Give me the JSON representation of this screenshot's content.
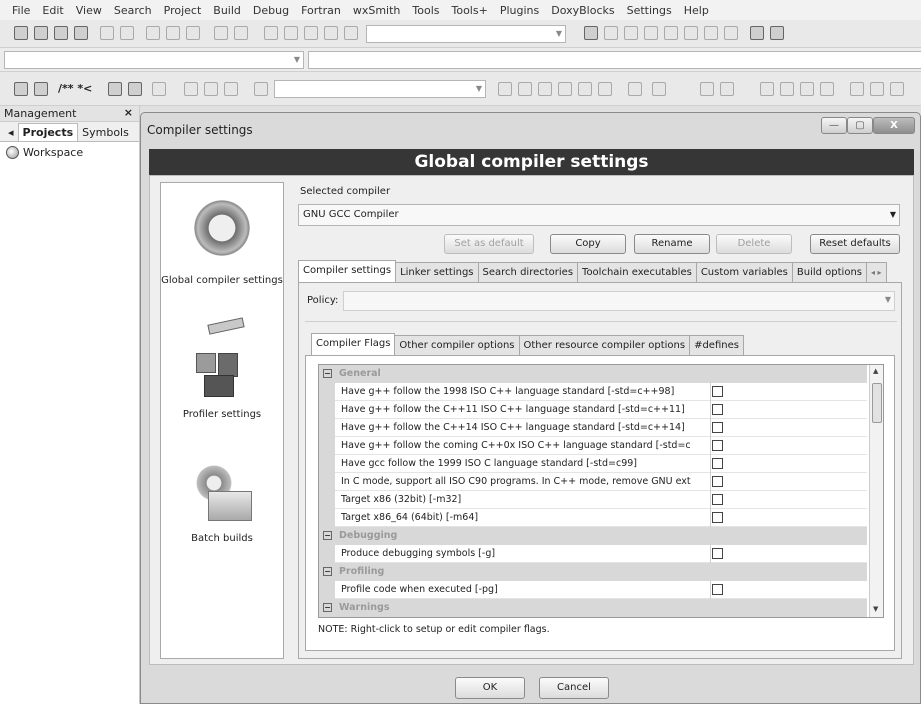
{
  "menu": [
    "File",
    "Edit",
    "View",
    "Search",
    "Project",
    "Build",
    "Debug",
    "Fortran",
    "wxSmith",
    "Tools",
    "Tools+",
    "Plugins",
    "DoxyBlocks",
    "Settings",
    "Help"
  ],
  "toolbar": {
    "comment_label": "/** *<"
  },
  "management": {
    "title": "Management",
    "close": "×",
    "tabs": [
      "Projects",
      "Symbols"
    ],
    "workspace": "Workspace"
  },
  "dialog": {
    "title": "Compiler settings",
    "header": "Global compiler settings",
    "window_buttons": {
      "minimize": "—",
      "maximize": "▢",
      "close": "X"
    },
    "sidebar": [
      {
        "label": "Global compiler settings",
        "icon": "gear-icon"
      },
      {
        "label": "Profiler settings",
        "icon": "caliper-icon"
      },
      {
        "label": "Batch builds",
        "icon": "batch-gear-icon"
      }
    ],
    "selected_compiler_label": "Selected compiler",
    "selected_compiler_value": "GNU GCC Compiler",
    "buttons": {
      "set_default": "Set as default",
      "copy": "Copy",
      "rename": "Rename",
      "delete": "Delete",
      "reset": "Reset defaults",
      "ok": "OK",
      "cancel": "Cancel"
    },
    "tabs": [
      "Compiler settings",
      "Linker settings",
      "Search directories",
      "Toolchain executables",
      "Custom variables",
      "Build options"
    ],
    "policy_label": "Policy:",
    "inner_tabs": [
      "Compiler Flags",
      "Other compiler options",
      "Other resource compiler options",
      "#defines"
    ],
    "flags": [
      {
        "type": "cat",
        "text": "General"
      },
      {
        "type": "opt",
        "text": "Have g++ follow the 1998 ISO C++ language standard  [-std=c++98]",
        "checked": false
      },
      {
        "type": "opt",
        "text": "Have g++ follow the C++11 ISO C++ language standard  [-std=c++11]",
        "checked": false
      },
      {
        "type": "opt",
        "text": "Have g++ follow the C++14 ISO C++ language standard  [-std=c++14]",
        "checked": false
      },
      {
        "type": "opt",
        "text": "Have g++ follow the coming C++0x ISO C++ language standard  [-std=c",
        "checked": false
      },
      {
        "type": "opt",
        "text": "Have gcc follow the 1999 ISO C language standard  [-std=c99]",
        "checked": false
      },
      {
        "type": "opt",
        "text": "In C mode, support all ISO C90 programs. In C++ mode, remove GNU ext",
        "checked": false
      },
      {
        "type": "opt",
        "text": "Target x86 (32bit)  [-m32]",
        "checked": false
      },
      {
        "type": "opt",
        "text": "Target x86_64 (64bit)  [-m64]",
        "checked": false
      },
      {
        "type": "cat",
        "text": "Debugging"
      },
      {
        "type": "opt",
        "text": "Produce debugging symbols  [-g]",
        "checked": false
      },
      {
        "type": "cat",
        "text": "Profiling"
      },
      {
        "type": "opt",
        "text": "Profile code when executed  [-pg]",
        "checked": false
      },
      {
        "type": "cat",
        "text": "Warnings"
      }
    ],
    "note": "NOTE: Right-click to setup or edit compiler flags."
  }
}
